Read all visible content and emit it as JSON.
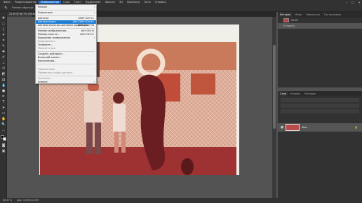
{
  "menubar": {
    "items": [
      "Файл",
      "Редактирование",
      "Изображение",
      "Слои",
      "Текст",
      "Выделение",
      "Фильтр",
      "3D",
      "Просмотр",
      "Окно",
      "Справка"
    ],
    "active_index": 2
  },
  "options": {
    "tool_label": "Размер образца:",
    "items": [
      "Шаблон",
      "Все слои"
    ]
  },
  "document": {
    "tab_title": "22.tif @ 66,7% (RGB/8)"
  },
  "status": {
    "zoom": "66,67%",
    "info": "Док: 3,05M/3,05M"
  },
  "image_menu": {
    "items": [
      {
        "label": "Режим",
        "shortcut": "",
        "submenu": true,
        "disabled": false,
        "highlight": false
      },
      {
        "label": "Коррекция",
        "shortcut": "",
        "submenu": true,
        "disabled": false,
        "highlight": false
      },
      {
        "label": "Автотон",
        "shortcut": "Shift+Ctrl+L",
        "submenu": false,
        "disabled": false,
        "highlight": false
      },
      {
        "label": "Автоконтраст",
        "shortcut": "Alt+Shift+Ctrl+L",
        "submenu": false,
        "disabled": false,
        "highlight": true
      },
      {
        "label": "Автоматическая цветовая коррекция",
        "shortcut": "Shift+Ctrl+B",
        "submenu": false,
        "disabled": false,
        "highlight": false
      },
      {
        "label": "Размер изображения...",
        "shortcut": "Alt+Ctrl+I",
        "submenu": false,
        "disabled": false,
        "highlight": false
      },
      {
        "label": "Размер холста...",
        "shortcut": "Alt+Ctrl+C",
        "submenu": false,
        "disabled": false,
        "highlight": false
      },
      {
        "label": "Вращение изображения",
        "shortcut": "",
        "submenu": true,
        "disabled": false,
        "highlight": false
      },
      {
        "label": "Кадрировать",
        "shortcut": "",
        "submenu": false,
        "disabled": true,
        "highlight": false
      },
      {
        "label": "Тримминг...",
        "shortcut": "",
        "submenu": false,
        "disabled": false,
        "highlight": false
      },
      {
        "label": "Показать все",
        "shortcut": "",
        "submenu": false,
        "disabled": true,
        "highlight": false
      },
      {
        "label": "Создать дубликат...",
        "shortcut": "",
        "submenu": false,
        "disabled": false,
        "highlight": false
      },
      {
        "label": "Внешний канал...",
        "shortcut": "",
        "submenu": false,
        "disabled": false,
        "highlight": false
      },
      {
        "label": "Вычисления...",
        "shortcut": "",
        "submenu": false,
        "disabled": false,
        "highlight": false
      },
      {
        "label": "Переменные",
        "shortcut": "",
        "submenu": true,
        "disabled": true,
        "highlight": false
      },
      {
        "label": "Применить набор данных...",
        "shortcut": "",
        "submenu": false,
        "disabled": true,
        "highlight": false
      },
      {
        "label": "Треппинг...",
        "shortcut": "",
        "submenu": false,
        "disabled": true,
        "highlight": false
      },
      {
        "label": "Анализ",
        "shortcut": "",
        "submenu": true,
        "disabled": false,
        "highlight": false
      }
    ]
  },
  "right_panel": {
    "top_tabs": [
      "История",
      "Инфо",
      "Навигатор",
      "Гистограмма"
    ],
    "history_items": [
      "22.tif",
      "Открыть"
    ],
    "layer_tabs": [
      "Слои",
      "Каналы",
      "Контуры"
    ],
    "layer_name": "Фон"
  }
}
